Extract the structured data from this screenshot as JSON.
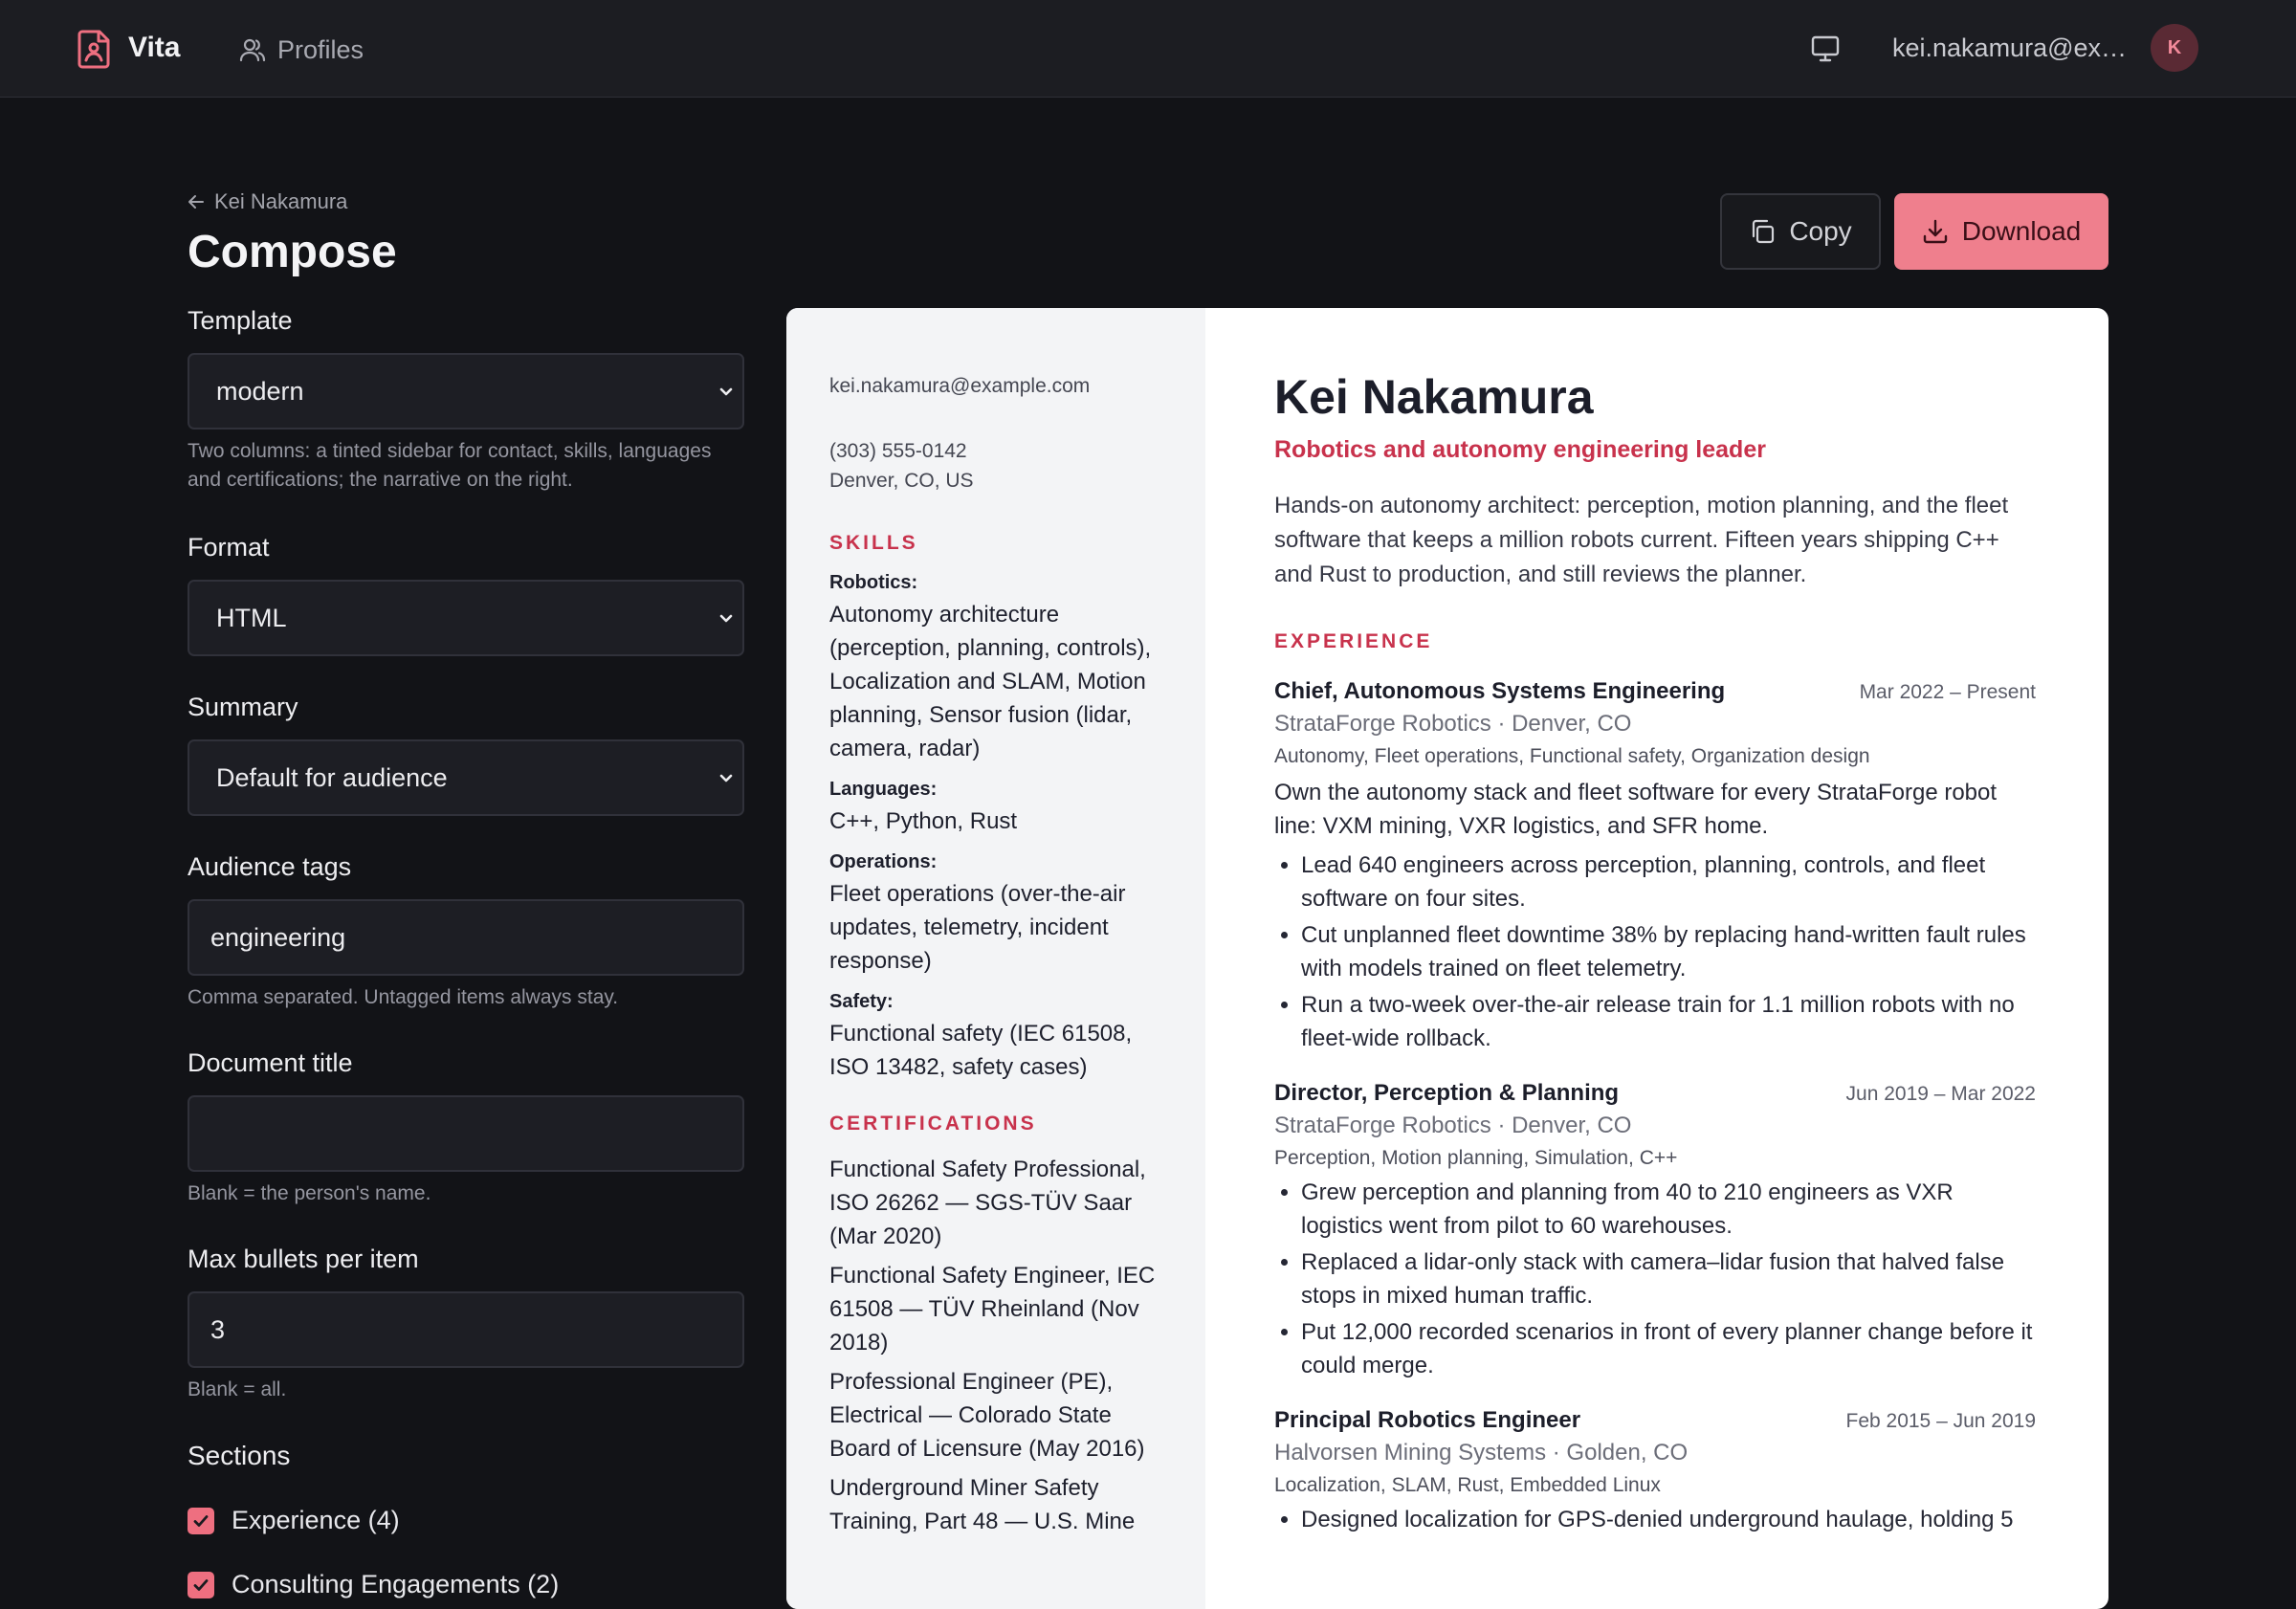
{
  "app": {
    "brand": "Vita",
    "nav_profiles": "Profiles",
    "user_email": "kei.nakamura@example.com",
    "avatar_initial": "K"
  },
  "header": {
    "back_label": "Kei Nakamura",
    "title": "Compose",
    "copy_label": "Copy",
    "download_label": "Download"
  },
  "form": {
    "template": {
      "label": "Template",
      "value": "modern",
      "help": "Two columns: a tinted sidebar for contact, skills, languages and certifications; the narrative on the right."
    },
    "format": {
      "label": "Format",
      "value": "HTML"
    },
    "summary": {
      "label": "Summary",
      "value": "Default for audience"
    },
    "audience_tags": {
      "label": "Audience tags",
      "value": "engineering",
      "help": "Comma separated. Untagged items always stay."
    },
    "document_title": {
      "label": "Document title",
      "value": "",
      "help": "Blank = the person's name."
    },
    "max_bullets": {
      "label": "Max bullets per item",
      "value": "3",
      "help": "Blank = all."
    },
    "sections": {
      "label": "Sections",
      "items": [
        {
          "label": "Experience (4)",
          "checked": true
        },
        {
          "label": "Consulting Engagements (2)",
          "checked": true
        }
      ]
    }
  },
  "resume": {
    "sidebar": {
      "email": "kei.nakamura@example.com",
      "phone": "(303) 555-0142",
      "location": "Denver, CO, US",
      "skills_heading": "SKILLS",
      "skills": [
        {
          "label": "Robotics:",
          "value": "Autonomy architecture (perception, planning, controls), Localization and SLAM, Motion planning, Sensor fusion (lidar, camera, radar)"
        },
        {
          "label": "Languages:",
          "value": "C++, Python, Rust"
        },
        {
          "label": "Operations:",
          "value": "Fleet operations (over-the-air updates, telemetry, incident response)"
        },
        {
          "label": "Safety:",
          "value": "Functional safety (IEC 61508, ISO 13482, safety cases)"
        }
      ],
      "certifications_heading": "CERTIFICATIONS",
      "certifications": [
        "Functional Safety Professional, ISO 26262 — SGS-TÜV Saar (Mar 2020)",
        "Functional Safety Engineer, IEC 61508 — TÜV Rheinland (Nov 2018)",
        "Professional Engineer (PE), Electrical — Colorado State Board of Licensure (May 2016)",
        "Underground Miner Safety Training, Part 48 — U.S. Mine"
      ]
    },
    "name": "Kei Nakamura",
    "headline": "Robotics and autonomy engineering leader",
    "summary": "Hands-on autonomy architect: perception, motion planning, and the fleet software that keeps a million robots current. Fifteen years shipping C++ and Rust to production, and still reviews the planner.",
    "experience_heading": "EXPERIENCE",
    "jobs": [
      {
        "role": "Chief, Autonomous Systems Engineering",
        "dates": "Mar 2022 – Present",
        "org": "StrataForge Robotics · Denver, CO",
        "tags": "Autonomy, Fleet operations, Functional safety, Organization design",
        "desc": "Own the autonomy stack and fleet software for every StrataForge robot line: VXM mining, VXR logistics, and SFR home.",
        "bullets": [
          "Lead 640 engineers across perception, planning, controls, and fleet software on four sites.",
          "Cut unplanned fleet downtime 38% by replacing hand-written fault rules with models trained on fleet telemetry.",
          "Run a two-week over-the-air release train for 1.1 million robots with no fleet-wide rollback."
        ]
      },
      {
        "role": "Director, Perception & Planning",
        "dates": "Jun 2019 – Mar 2022",
        "org": "StrataForge Robotics · Denver, CO",
        "tags": "Perception, Motion planning, Simulation, C++",
        "desc": "",
        "bullets": [
          "Grew perception and planning from 40 to 210 engineers as VXR logistics went from pilot to 60 warehouses.",
          "Replaced a lidar-only stack with camera–lidar fusion that halved false stops in mixed human traffic.",
          "Put 12,000 recorded scenarios in front of every planner change before it could merge."
        ]
      },
      {
        "role": "Principal Robotics Engineer",
        "dates": "Feb 2015 – Jun 2019",
        "org": "Halvorsen Mining Systems · Golden, CO",
        "tags": "Localization, SLAM, Rust, Embedded Linux",
        "desc": "",
        "bullets": [
          "Designed localization for GPS-denied underground haulage, holding 5"
        ]
      }
    ]
  }
}
